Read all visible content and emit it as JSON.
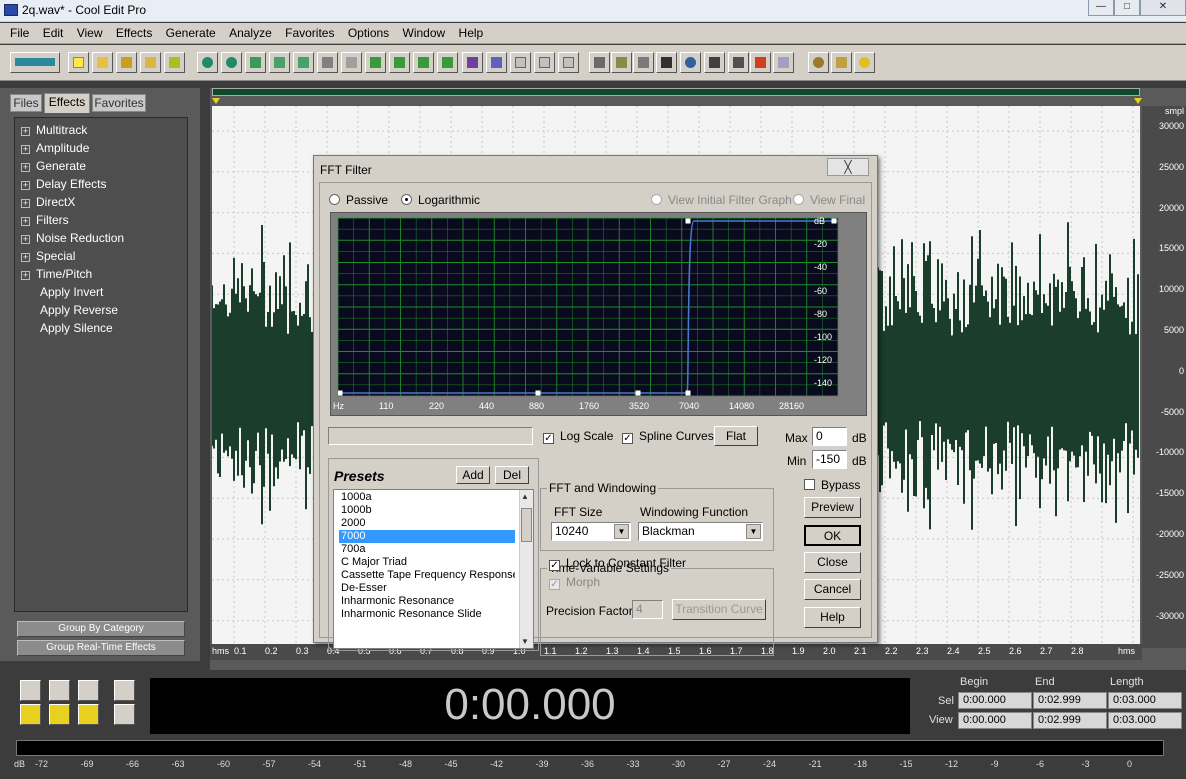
{
  "window": {
    "title": "2q.wav* - Cool Edit Pro"
  },
  "menu": [
    "File",
    "Edit",
    "View",
    "Effects",
    "Generate",
    "Analyze",
    "Favorites",
    "Options",
    "Window",
    "Help"
  ],
  "panel": {
    "tabs": [
      "Files",
      "Effects",
      "Favorites"
    ],
    "tree": [
      {
        "label": "Multitrack",
        "expandable": true
      },
      {
        "label": "Amplitude",
        "expandable": true
      },
      {
        "label": "Generate",
        "expandable": true
      },
      {
        "label": "Delay Effects",
        "expandable": true
      },
      {
        "label": "DirectX",
        "expandable": true
      },
      {
        "label": "Filters",
        "expandable": true
      },
      {
        "label": "Noise Reduction",
        "expandable": true
      },
      {
        "label": "Special",
        "expandable": true
      },
      {
        "label": "Time/Pitch",
        "expandable": true
      },
      {
        "label": "Apply Invert",
        "expandable": false
      },
      {
        "label": "Apply Reverse",
        "expandable": false
      },
      {
        "label": "Apply Silence",
        "expandable": false
      }
    ],
    "group_by_category": "Group By Category",
    "group_realtime": "Group Real-Time Effects"
  },
  "wave": {
    "ruler_unit": "smpl",
    "ruler_labels": [
      "30000",
      "25000",
      "20000",
      "15000",
      "10000",
      "5000",
      "0",
      "-5000",
      "-10000",
      "-15000",
      "-20000",
      "-25000",
      "-30000"
    ],
    "time_labels": [
      "hms",
      "0.1",
      "0.2",
      "0.3",
      "0.4",
      "0.5",
      "0.6",
      "0.7",
      "0.8",
      "0.9",
      "1.0",
      "1.1",
      "1.2",
      "1.3",
      "1.4",
      "1.5",
      "1.6",
      "1.7",
      "1.8",
      "1.9",
      "2.0",
      "2.1",
      "2.2",
      "2.3",
      "2.4",
      "2.5",
      "2.6",
      "2.7",
      "2.8",
      "hms"
    ]
  },
  "dialog": {
    "title": "FFT Filter",
    "close": "╳",
    "mode_passive": "Passive",
    "mode_log": "Logarithmic",
    "view_initial": "View Initial Filter Graph",
    "view_final": "View Final",
    "graph": {
      "db_labels": [
        "dB",
        "-20",
        "-40",
        "-60",
        "-80",
        "-100",
        "-120",
        "-140"
      ],
      "freq_labels": [
        "Hz",
        "110",
        "220",
        "440",
        "880",
        "1760",
        "3520",
        "7040",
        "14080",
        "28160"
      ],
      "cutoff_hz": 7040
    },
    "log_scale": "Log Scale",
    "spline_curves": "Spline Curves",
    "flat": "Flat",
    "max_label": "Max",
    "max_value": "0",
    "min_label": "Min",
    "min_value": "-150",
    "db_unit": "dB",
    "bypass": "Bypass",
    "presets_title": "Presets",
    "add": "Add",
    "del": "Del",
    "presets": [
      "1000a",
      "1000b",
      "2000",
      "7000",
      "700a",
      "C Major Triad",
      "Cassette Tape Frequency Response",
      "De-Esser",
      "Inharmonic Resonance",
      "Inharmonic Resonance Slide"
    ],
    "selected_preset": "7000",
    "fft_group": "FFT and Windowing",
    "fft_size_label": "FFT Size",
    "fft_size": "10240",
    "window_label": "Windowing Function",
    "window_fn": "Blackman",
    "tv_group": "Time-Variable Settings",
    "lock": "Lock to Constant Filter",
    "morph": "Morph",
    "precision_label": "Precision Factor",
    "precision_value": "4",
    "transition_curve": "Transition Curve",
    "preview": "Preview",
    "ok": "OK",
    "close_btn": "Close",
    "cancel": "Cancel",
    "help": "Help"
  },
  "transport": {
    "time": "0:00.000",
    "headers": [
      "Begin",
      "End",
      "Length"
    ],
    "sel_label": "Sel",
    "view_label": "View",
    "sel": [
      "0:00.000",
      "0:02.999",
      "0:03.000"
    ],
    "view": [
      "0:00.000",
      "0:02.999",
      "0:03.000"
    ]
  },
  "levels": [
    "dB",
    "-72",
    "-69",
    "-66",
    "-63",
    "-60",
    "-57",
    "-54",
    "-51",
    "-48",
    "-45",
    "-42",
    "-39",
    "-36",
    "-33",
    "-30",
    "-27",
    "-24",
    "-21",
    "-18",
    "-15",
    "-12",
    "-9",
    "-6",
    "-3",
    "0"
  ],
  "colors": {
    "wave": "#1a3d2c",
    "graph_bg": "#0a0a1e",
    "grid": "#1e8c2a",
    "curve": "#4a7ad0",
    "accent": "#3399ff"
  }
}
